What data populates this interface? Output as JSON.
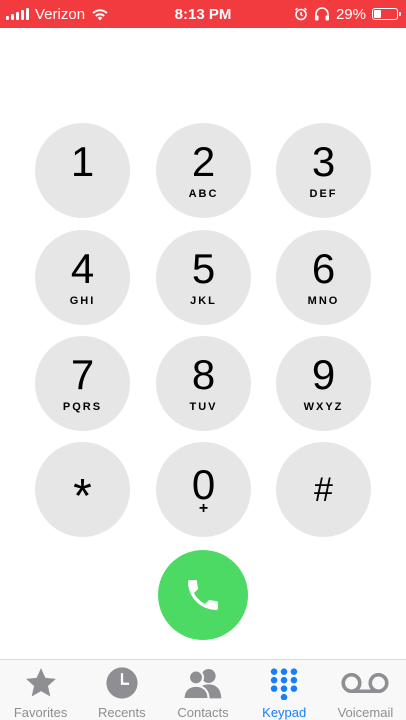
{
  "status_bar": {
    "carrier": "Verizon",
    "time": "8:13 PM",
    "battery": "29%",
    "battery_level": 0.29
  },
  "keypad": {
    "keys": [
      {
        "digit": "1",
        "letters": ""
      },
      {
        "digit": "2",
        "letters": "ABC"
      },
      {
        "digit": "3",
        "letters": "DEF"
      },
      {
        "digit": "4",
        "letters": "GHI"
      },
      {
        "digit": "5",
        "letters": "JKL"
      },
      {
        "digit": "6",
        "letters": "MNO"
      },
      {
        "digit": "7",
        "letters": "PQRS"
      },
      {
        "digit": "8",
        "letters": "TUV"
      },
      {
        "digit": "9",
        "letters": "WXYZ"
      },
      {
        "digit": "*",
        "letters": ""
      },
      {
        "digit": "0",
        "letters": "+"
      },
      {
        "digit": "#",
        "letters": ""
      }
    ]
  },
  "call_button": {
    "icon": "phone-icon",
    "color": "#4cd964"
  },
  "tab_bar": {
    "active_color": "#147efb",
    "tabs": [
      {
        "label": "Favorites",
        "icon": "star-icon"
      },
      {
        "label": "Recents",
        "icon": "clock-icon"
      },
      {
        "label": "Contacts",
        "icon": "contacts-icon"
      },
      {
        "label": "Keypad",
        "icon": "keypad-icon",
        "active": true
      },
      {
        "label": "Voicemail",
        "icon": "voicemail-icon"
      }
    ]
  }
}
